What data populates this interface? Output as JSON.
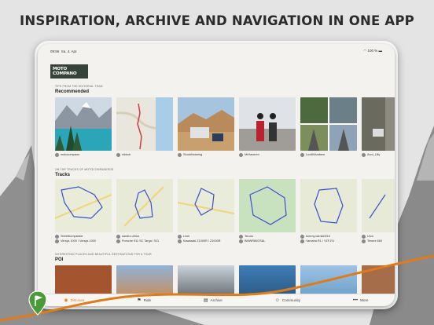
{
  "headline": "INSPIRATION, ARCHIVE AND NAVIGATION IN ONE APP",
  "status": {
    "time": "09:56",
    "date": "Sa. 4. Apr.",
    "battery": "100 %"
  },
  "logo": {
    "line1": "MOTO",
    "line2": "COMPANO"
  },
  "recommended": {
    "kicker": "TIPS FROM THE EDITORIAL TEAM",
    "title": "Recommended",
    "cards": [
      {
        "author": "motocompano",
        "sub": ""
      },
      {
        "author": "nikkob",
        "sub": ""
      },
      {
        "author": "StuckMotoring",
        "sub": ""
      },
      {
        "author": "MrHaveren",
        "sub": ""
      },
      {
        "author": "Luci69Andrew",
        "sub": ""
      },
      {
        "author": "Anni_Lilly",
        "sub": ""
      }
    ]
  },
  "tracks": {
    "kicker": "ON THE TRACKS OF MOTOCOMPANEROS",
    "title": "Tracks",
    "cards": [
      {
        "author": "Streetbumpsister",
        "vehicle": "Versys 1000 / Versys 1000"
      },
      {
        "author": "sandro.ulrica",
        "vehicle": "Porsche 911 SC Targa / 911"
      },
      {
        "author": "Linei",
        "vehicle": "Kawasaki Z1000R / Z1000R"
      },
      {
        "author": "TeLuis",
        "vehicle": "BMWR80GS&L"
      },
      {
        "author": "tommy.varnia0210",
        "vehicle": "Yamaha R1 / YZF-R1"
      },
      {
        "author": "Urzu",
        "vehicle": "Tenere 660"
      }
    ]
  },
  "poi": {
    "kicker": "INTERESTING PLACES AND BEAUTIFUL DESTINATIONS FOR A TOUR",
    "title": "POI"
  },
  "tabs": [
    {
      "label": "Discover",
      "icon": "discover-icon"
    },
    {
      "label": "Ride",
      "icon": "ride-icon"
    },
    {
      "label": "Archive",
      "icon": "archive-icon"
    },
    {
      "label": "Community",
      "icon": "community-icon"
    },
    {
      "label": "More",
      "icon": "more-icon"
    }
  ],
  "colors": {
    "accent": "#e07b1a",
    "logo_bg": "#35433b",
    "route": "#3a4fd0"
  }
}
